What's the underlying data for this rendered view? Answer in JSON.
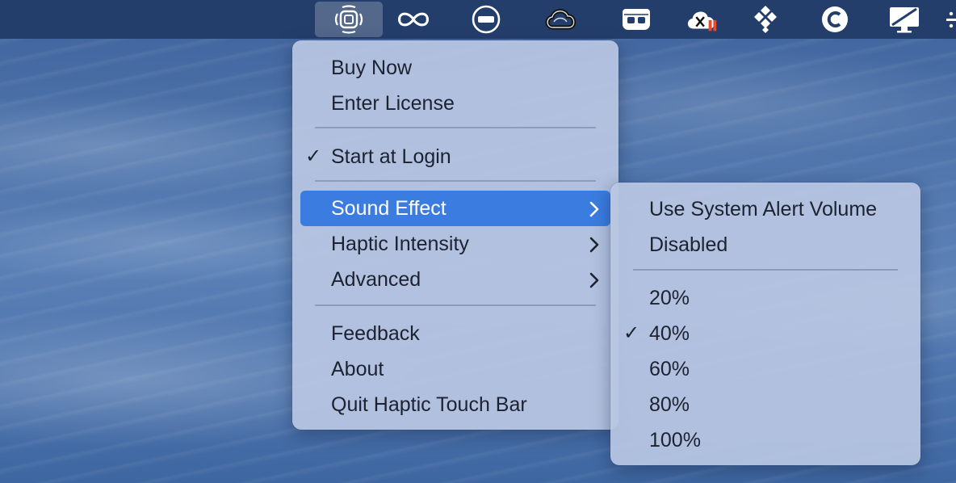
{
  "menubar": {
    "icons": [
      {
        "name": "haptic-touch-bar-icon",
        "active": true
      },
      {
        "name": "infinity-icon"
      },
      {
        "name": "battery-minus-icon"
      },
      {
        "name": "creative-cloud-icon"
      },
      {
        "name": "game-controller-icon"
      },
      {
        "name": "cloud-error-icon"
      },
      {
        "name": "dropbox-icon"
      },
      {
        "name": "c-circle-icon"
      },
      {
        "name": "display-slash-icon"
      }
    ]
  },
  "main_menu": {
    "buy_now": "Buy Now",
    "enter_license": "Enter License",
    "start_at_login": "Start at Login",
    "start_at_login_checked": true,
    "sound_effect": "Sound Effect",
    "haptic_intensity": "Haptic Intensity",
    "advanced": "Advanced",
    "feedback": "Feedback",
    "about": "About",
    "quit": "Quit Haptic Touch Bar"
  },
  "sound_submenu": {
    "use_system_alert_volume": "Use System Alert Volume",
    "disabled": "Disabled",
    "levels": [
      "20%",
      "40%",
      "60%",
      "80%",
      "100%"
    ],
    "selected": "40%"
  },
  "colors": {
    "menubar": "#243e6c",
    "highlight": "#3b7ce0",
    "menu_bg": "#b8c6e2"
  },
  "glyphs": {
    "check": "✓"
  }
}
